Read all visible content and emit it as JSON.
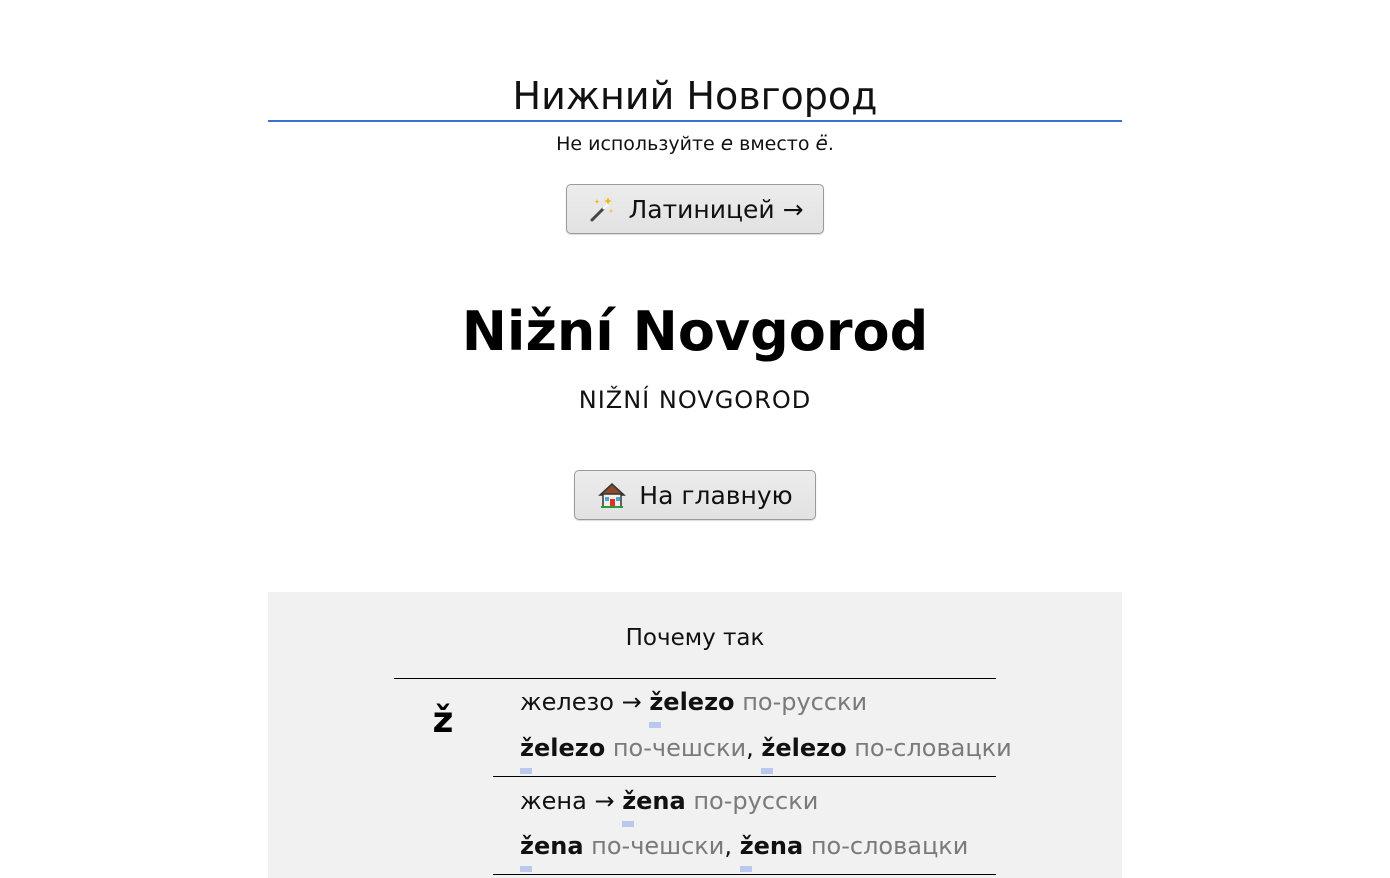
{
  "input": {
    "value": "Нижний Новгород"
  },
  "hint": {
    "before": "Не используйте ",
    "e": "е",
    "middle": " вместо ",
    "yo": "ё",
    "after": "."
  },
  "translit_button": {
    "label": "Латиницей →",
    "icon": "magic-wand-icon"
  },
  "result": {
    "latin": "Nižní Novgorod",
    "caps": "NIŽNÍ NOVGOROD"
  },
  "home_button": {
    "label": "На главную",
    "icon": "house-icon"
  },
  "explanation": {
    "title": "Почему так",
    "letter": "ž",
    "examples": [
      {
        "russian": "железо",
        "arrow": "→",
        "latin": "železo",
        "lang_ru": "по-русски",
        "czech": "železo",
        "lang_cz": "по-чешски",
        "comma": ",",
        "slovak": "železo",
        "lang_sk": "по-словацки"
      },
      {
        "russian": "жена",
        "arrow": "→",
        "latin": "žena",
        "lang_ru": "по-русски",
        "czech": "žena",
        "lang_cz": "по-чешски",
        "comma": ",",
        "slovak": "žena",
        "lang_sk": "по-словацки"
      }
    ]
  },
  "colors": {
    "accent": "#3b6fd1",
    "highlight": "#b9c8ec",
    "panel": "#f1f1f1",
    "muted": "#7a7a7a"
  }
}
